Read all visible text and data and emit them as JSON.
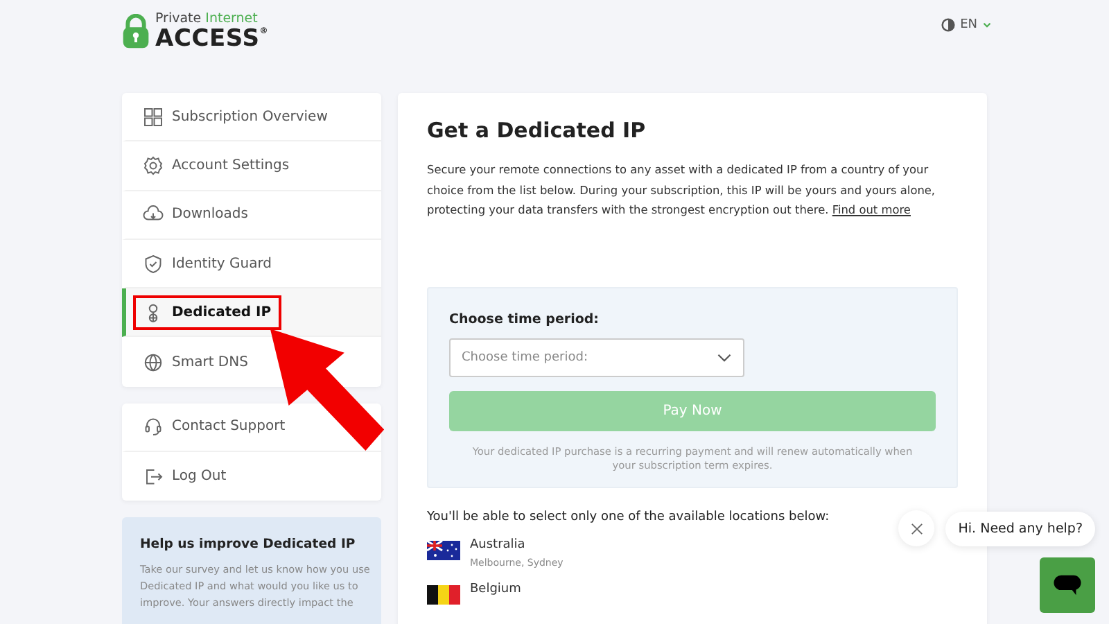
{
  "header": {
    "logo_top_plain": "Private",
    "logo_top_accent": "Internet",
    "logo_main": "ACCESS",
    "logo_mark": "®",
    "language": "EN"
  },
  "sidebar": {
    "items": [
      {
        "label": "Subscription Overview",
        "kind": "grid",
        "selected": false,
        "callout": false
      },
      {
        "label": "Account Settings",
        "kind": "gear",
        "selected": false,
        "callout": false
      },
      {
        "label": "Downloads",
        "kind": "cloud",
        "selected": false,
        "callout": false
      },
      {
        "label": "Identity Guard",
        "kind": "shield",
        "selected": false,
        "callout": false
      },
      {
        "label": "Dedicated IP",
        "kind": "pin",
        "selected": true,
        "callout": true
      },
      {
        "label": "Smart DNS",
        "kind": "globe",
        "selected": false,
        "callout": false
      }
    ],
    "secondary_items": [
      {
        "label": "Contact Support",
        "kind": "headset"
      },
      {
        "label": "Log Out",
        "kind": "logout"
      }
    ],
    "survey": {
      "title": "Help us improve Dedicated IP",
      "text": "Take our survey and let us know how you use Dedicated IP and what would you like us to improve. Your answers directly impact the"
    }
  },
  "main": {
    "title": "Get a Dedicated IP",
    "intro": "Secure your remote connections to any asset with a dedicated IP from a country of your choice from the list below. During your subscription, this IP will be yours and yours alone, protecting your data transfers with the strongest encryption out there.",
    "link": "Find out more",
    "purchase": {
      "label": "Choose time period:",
      "select": {
        "placeholder": "Choose time period:"
      },
      "button": {
        "label": "Pay Now",
        "disabled": true
      },
      "note": "Your dedicated IP purchase is a recurring payment and will renew automatically when your subscription term expires."
    },
    "locations_label": "You'll be able to select only one of the available locations below:",
    "locations": [
      {
        "country": "Australia",
        "cities": "Melbourne, Sydney",
        "kind": "au"
      },
      {
        "country": "Belgium",
        "kind": "be"
      }
    ]
  },
  "chat": {
    "greeting": "Hi. Need any help?"
  }
}
